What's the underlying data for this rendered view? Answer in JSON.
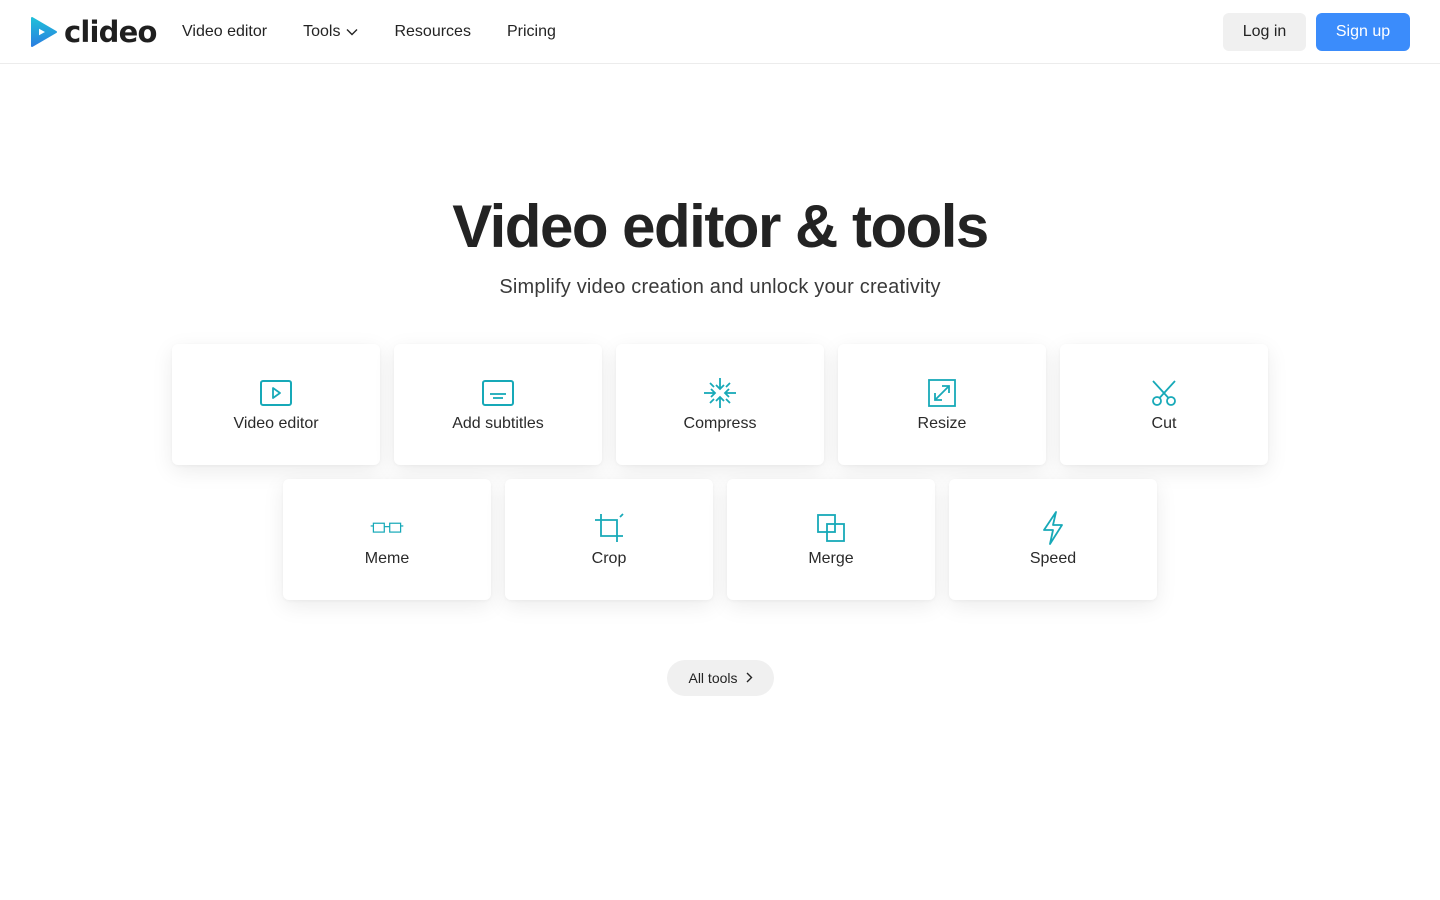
{
  "brand": {
    "name": "clideo",
    "logo_color_top": "#1fbfd9",
    "logo_color_bottom": "#2a7fe0"
  },
  "nav": {
    "items": [
      {
        "label": "Video editor"
      },
      {
        "label": "Tools",
        "has_dropdown": true
      },
      {
        "label": "Resources"
      },
      {
        "label": "Pricing"
      }
    ]
  },
  "auth": {
    "login_label": "Log in",
    "signup_label": "Sign up",
    "signup_color": "#3b8cfb"
  },
  "hero": {
    "title": "Video editor & tools",
    "subtitle": "Simplify video creation and unlock your creativity"
  },
  "tools": [
    {
      "label": "Video editor",
      "icon": "play-icon"
    },
    {
      "label": "Add subtitles",
      "icon": "subtitles-icon"
    },
    {
      "label": "Compress",
      "icon": "compress-icon"
    },
    {
      "label": "Resize",
      "icon": "resize-icon"
    },
    {
      "label": "Cut",
      "icon": "scissors-icon"
    },
    {
      "label": "Meme",
      "icon": "meme-glasses-icon"
    },
    {
      "label": "Crop",
      "icon": "crop-icon"
    },
    {
      "label": "Merge",
      "icon": "merge-icon"
    },
    {
      "label": "Speed",
      "icon": "lightning-icon"
    }
  ],
  "icon_color": "#17a9b8",
  "all_tools": {
    "label": "All tools"
  }
}
